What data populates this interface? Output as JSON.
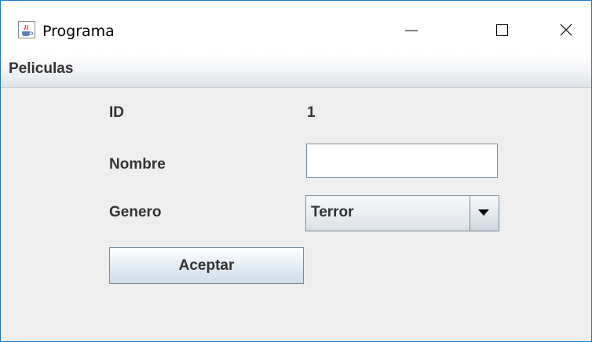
{
  "window": {
    "title": "Programa",
    "icon": "java-cup-icon",
    "controls": [
      "minimize-icon",
      "maximize-icon",
      "close-icon"
    ]
  },
  "menubar": {
    "items": [
      {
        "label": "Peliculas"
      }
    ]
  },
  "form": {
    "id_label": "ID",
    "id_value": "1",
    "nombre_label": "Nombre",
    "nombre_value": "",
    "genero_label": "Genero",
    "genero_selected": "Terror",
    "submit_label": "Aceptar"
  },
  "colors": {
    "window_border": "#1979ca",
    "background": "#eeeeee",
    "text": "#333333"
  }
}
